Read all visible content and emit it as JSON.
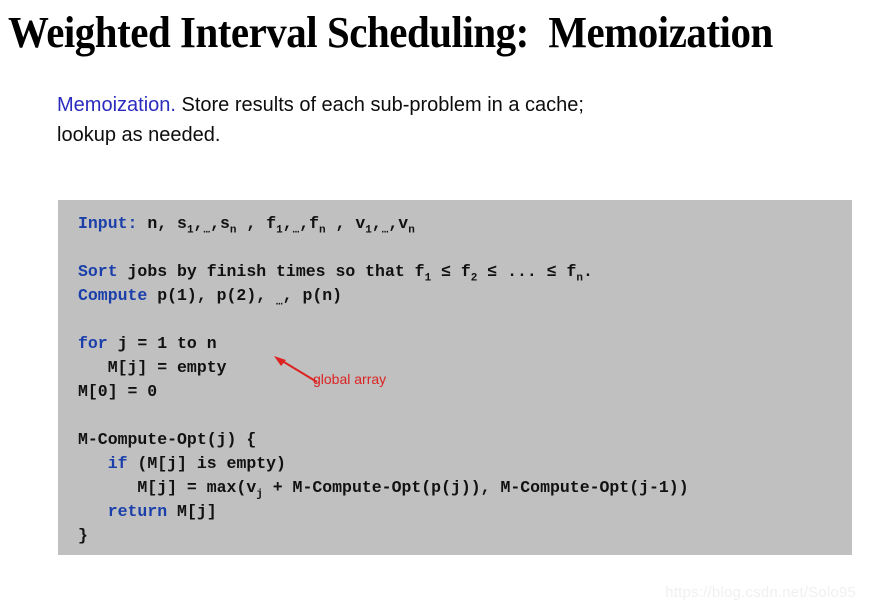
{
  "slide": {
    "title": "Weighted Interval Scheduling:  Memoization",
    "body": {
      "lead": "Memoization.",
      "rest": "  Store results of each sub-problem in a cache;",
      "line2": "lookup as needed."
    },
    "code": {
      "background_color": "#c0c0c0",
      "keyword_color": "#1a3faa",
      "text_color": "#111111",
      "lines": [
        {
          "id": "line-input",
          "segments": [
            {
              "text": "Input:",
              "type": "keyword"
            },
            {
              "text": " n, s",
              "type": "plain"
            },
            {
              "text": "1",
              "type": "sub"
            },
            {
              "text": ",",
              "type": "plain"
            },
            {
              "text": "…",
              "type": "dots"
            },
            {
              "text": ",s",
              "type": "plain"
            },
            {
              "text": "n",
              "type": "sub"
            },
            {
              "text": " , f",
              "type": "plain"
            },
            {
              "text": "1",
              "type": "sub"
            },
            {
              "text": ",",
              "type": "plain"
            },
            {
              "text": "…",
              "type": "dots"
            },
            {
              "text": ",f",
              "type": "plain"
            },
            {
              "text": "n",
              "type": "sub"
            },
            {
              "text": " , v",
              "type": "plain"
            },
            {
              "text": "1",
              "type": "sub"
            },
            {
              "text": ",",
              "type": "plain"
            },
            {
              "text": "…",
              "type": "dots"
            },
            {
              "text": ",v",
              "type": "plain"
            },
            {
              "text": "n",
              "type": "sub"
            }
          ]
        },
        {
          "id": "line-blank-1",
          "segments": []
        },
        {
          "id": "line-sort",
          "segments": [
            {
              "text": "Sort",
              "type": "keyword"
            },
            {
              "text": " jobs by finish times so that f",
              "type": "plain"
            },
            {
              "text": "1",
              "type": "sub"
            },
            {
              "text": " ≤ f",
              "type": "plain"
            },
            {
              "text": "2",
              "type": "sub"
            },
            {
              "text": " ≤ ... ≤ f",
              "type": "plain"
            },
            {
              "text": "n",
              "type": "sub"
            },
            {
              "text": ".",
              "type": "plain"
            }
          ]
        },
        {
          "id": "line-compute",
          "segments": [
            {
              "text": "Compute",
              "type": "keyword"
            },
            {
              "text": " p(1), p(2), ",
              "type": "plain"
            },
            {
              "text": "…",
              "type": "dots"
            },
            {
              "text": ", p(n)",
              "type": "plain"
            }
          ]
        },
        {
          "id": "line-blank-2",
          "segments": []
        },
        {
          "id": "line-for",
          "segments": [
            {
              "text": "for",
              "type": "keyword"
            },
            {
              "text": " j = 1 to n",
              "type": "plain"
            }
          ]
        },
        {
          "id": "line-m-empty",
          "segments": [
            {
              "text": "   M[j] = empty",
              "type": "plain"
            }
          ]
        },
        {
          "id": "line-m0",
          "segments": [
            {
              "text": "M[0] = 0",
              "type": "plain"
            }
          ]
        },
        {
          "id": "line-blank-3",
          "segments": []
        },
        {
          "id": "line-func-header",
          "segments": [
            {
              "text": "M-Compute-Opt(j) {",
              "type": "plain"
            }
          ]
        },
        {
          "id": "line-if",
          "segments": [
            {
              "text": "   ",
              "type": "plain"
            },
            {
              "text": "if",
              "type": "keyword"
            },
            {
              "text": " (M[j] is empty)",
              "type": "plain"
            }
          ]
        },
        {
          "id": "line-max",
          "segments": [
            {
              "text": "      M[j] = max(v",
              "type": "plain"
            },
            {
              "text": "j",
              "type": "sub"
            },
            {
              "text": " + M-Compute-Opt(p(j)), M-Compute-Opt(j-1))",
              "type": "plain"
            }
          ]
        },
        {
          "id": "line-return",
          "segments": [
            {
              "text": "   ",
              "type": "plain"
            },
            {
              "text": "return",
              "type": "keyword"
            },
            {
              "text": " M[j]",
              "type": "plain"
            }
          ]
        },
        {
          "id": "line-close",
          "segments": [
            {
              "text": "}",
              "type": "plain"
            }
          ]
        }
      ]
    },
    "annotation": {
      "label": "global array",
      "color": "#dd2222"
    },
    "watermark": "https://blog.csdn.net/Solo95"
  }
}
